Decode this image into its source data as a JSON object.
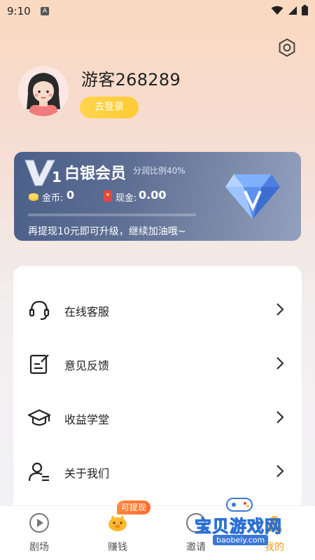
{
  "status_bar": {
    "time": "9:10",
    "notification_letter": "A"
  },
  "profile": {
    "username": "游客268289",
    "login_label": "去登录"
  },
  "vip": {
    "level": "1",
    "title": "白银会员",
    "ratio_text": "分润比例40%",
    "coin_label": "金币:",
    "coin_value": "0",
    "cash_label": "现金:",
    "cash_value": "0.00",
    "progress": 0,
    "upgrade_text": "再提现10元即可升级，继续加油哦~"
  },
  "menu": {
    "items": [
      {
        "label": "在线客服",
        "icon": "headset-icon"
      },
      {
        "label": "意见反馈",
        "icon": "edit-note-icon"
      },
      {
        "label": "收益学堂",
        "icon": "graduation-cap-icon"
      },
      {
        "label": "关于我们",
        "icon": "user-list-icon"
      }
    ]
  },
  "tabbar": {
    "tabs": [
      {
        "label": "剧场",
        "icon": "play-circle-icon"
      },
      {
        "label": "赚钱",
        "icon": "piggy-bank-icon",
        "badge": "可提现"
      },
      {
        "label": "邀请",
        "icon": "invite-icon"
      },
      {
        "label": "我的",
        "icon": "profile-icon"
      }
    ]
  },
  "watermark": {
    "text": "宝贝游戏网",
    "url": "baobeiy.com"
  },
  "colors": {
    "accent": "#ffcc33",
    "vip_card": "#5e6f94",
    "badge": "#ff6a2a"
  }
}
